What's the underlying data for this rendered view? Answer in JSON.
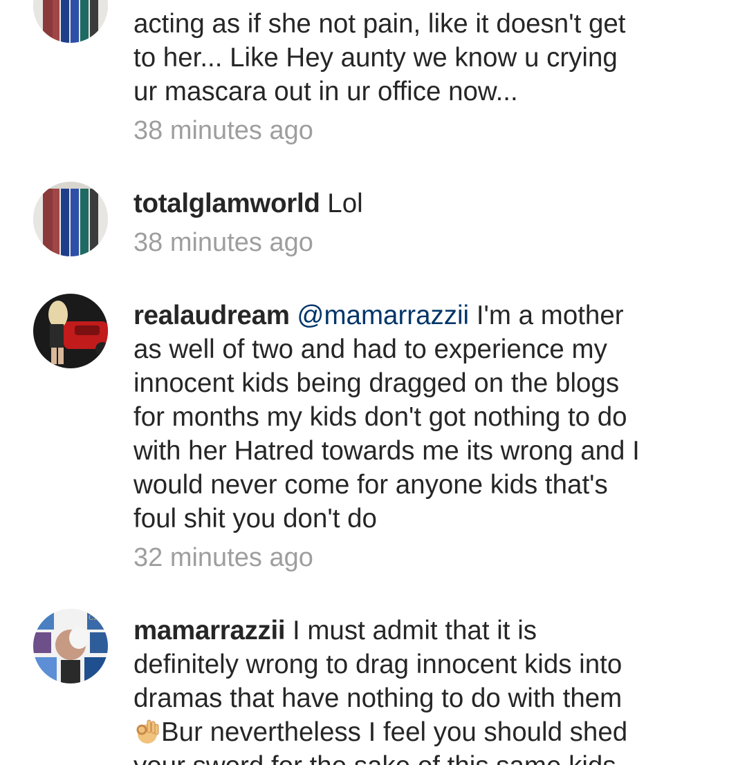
{
  "comments": [
    {
      "username": "",
      "mention": "",
      "lines": [
        "acting as if she not pain, like it doesn't get",
        "to her... Like  Hey aunty we know u crying",
        "ur mascara out in ur office now..."
      ],
      "time": "38 minutes ago"
    },
    {
      "username": "totalglamworld",
      "text": "Lol",
      "time": "38 minutes ago"
    },
    {
      "username": "realaudream",
      "mention": "@mamarrazzii",
      "first_line_rest": "I'm a mother",
      "lines": [
        "as well  of two and had to experience my",
        "innocent kids being dragged on the blogs",
        "for months my kids don't got nothing to do",
        "with her Hatred towards me its wrong and I",
        "would never come for anyone kids that's",
        "foul shit you don't do"
      ],
      "time": "32 minutes ago"
    },
    {
      "username": "mamarrazzii",
      "first_line_rest": "I must admit that it is",
      "lines": [
        "definitely wrong to drag innocent kids into",
        "dramas that have nothing to do with them",
        "Bur nevertheless I feel you should shed",
        "your sword for the sake of this same kids"
      ],
      "emoji": "ok-hand-emoji"
    }
  ]
}
